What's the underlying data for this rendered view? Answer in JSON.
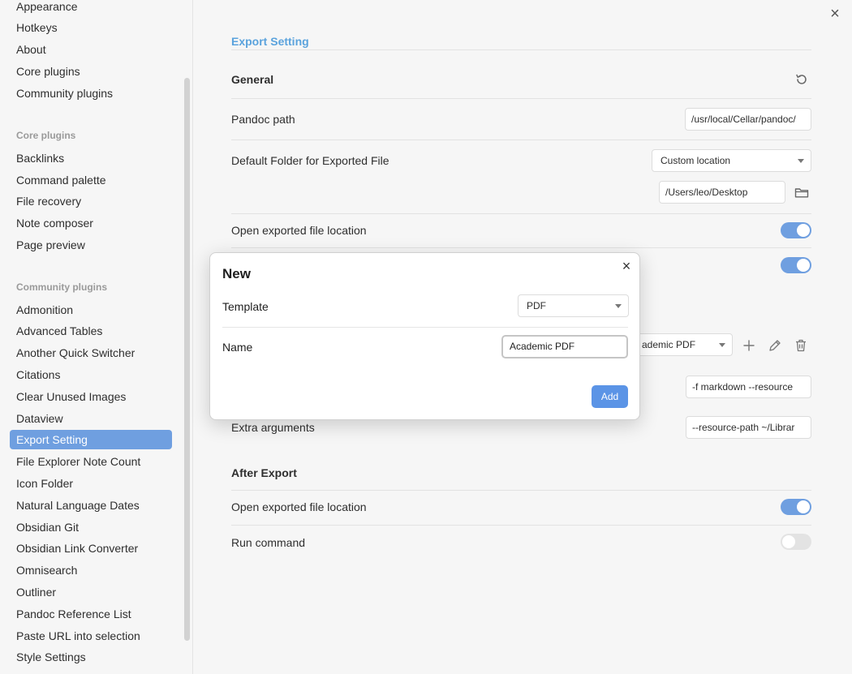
{
  "sidebar": {
    "options_items": [
      "Appearance",
      "Hotkeys",
      "About",
      "Core plugins",
      "Community plugins"
    ],
    "core_header": "Core plugins",
    "core_items": [
      "Backlinks",
      "Command palette",
      "File recovery",
      "Note composer",
      "Page preview"
    ],
    "community_header": "Community plugins",
    "community_items": [
      "Admonition",
      "Advanced Tables",
      "Another Quick Switcher",
      "Citations",
      "Clear Unused Images",
      "Dataview",
      "Export Setting",
      "File Explorer Note Count",
      "Icon Folder",
      "Natural Language Dates",
      "Obsidian Git",
      "Obsidian Link Converter",
      "Omnisearch",
      "Outliner",
      "Pandoc Reference List",
      "Paste URL into selection",
      "Style Settings"
    ],
    "active_item": "Export Setting"
  },
  "main": {
    "title": "Export Setting",
    "general_heading": "General",
    "pandoc_path_label": "Pandoc path",
    "pandoc_path_value": "/usr/local/Cellar/pandoc/",
    "default_folder_label": "Default Folder for Exported File",
    "default_folder_dropdown": "Custom location",
    "folder_path_value": "/Users/leo/Desktop",
    "open_location_label": "Open exported file location",
    "open_location_on": true,
    "second_toggle_on": true,
    "template_dropdown_partial": "ademic PDF",
    "arguments_value": "-f markdown --resource",
    "extra_arguments_label": "Extra arguments",
    "extra_arguments_value": "--resource-path ~/Librar",
    "after_export_heading": "After Export",
    "after_open_location_label": "Open exported file location",
    "after_open_location_on": true,
    "run_command_label": "Run command",
    "run_command_on": false
  },
  "modal": {
    "title": "New",
    "template_label": "Template",
    "template_value": "PDF",
    "name_label": "Name",
    "name_value": "Academic PDF",
    "add_label": "Add"
  },
  "colors": {
    "accent": "#6f9fe0",
    "title_blue": "#5ba3dd",
    "add_button": "#5b94e6"
  }
}
